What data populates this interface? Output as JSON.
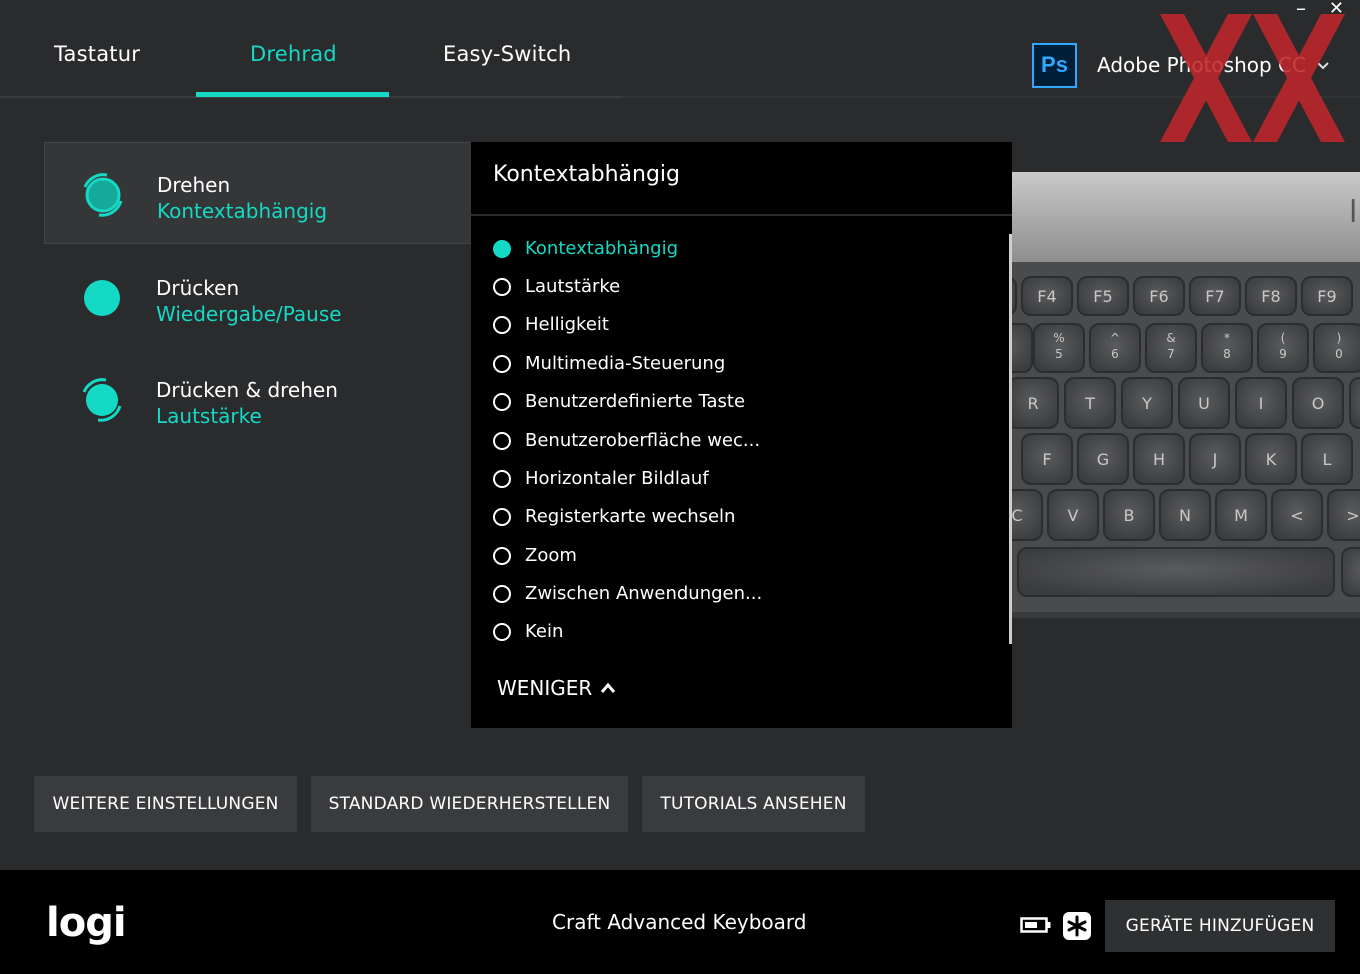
{
  "window": {
    "minimize_label": "–",
    "close_label": "✕"
  },
  "tabs": [
    {
      "label": "Tastatur",
      "active": false
    },
    {
      "label": "Drehrad",
      "active": true
    },
    {
      "label": "Easy-Switch",
      "active": false
    }
  ],
  "app_selector": {
    "icon_text": "Ps",
    "name": "Adobe Photoshop CC",
    "icon": "chevron-down-icon"
  },
  "settings": [
    {
      "title": "Drehen",
      "value": "Kontextabhängig",
      "selected": true,
      "icon": "rotate-dial-icon"
    },
    {
      "title": "Drücken",
      "value": "Wiedergabe/Pause",
      "selected": false,
      "icon": "press-dial-icon"
    },
    {
      "title": "Drücken & drehen",
      "value": "Lautstärke",
      "selected": false,
      "icon": "press-rotate-dial-icon"
    }
  ],
  "dropdown": {
    "title": "Kontextabhängig",
    "options": [
      "Kontextabhängig",
      "Lautstärke",
      "Helligkeit",
      "Multimedia-Steuerung",
      "Benutzerdefinierte Taste",
      "Benutzeroberfläche wec...",
      "Horizontaler Bildlauf",
      "Registerkarte wechseln",
      "Zoom",
      "Zwischen Anwendungen...",
      "Kein"
    ],
    "selected": "Kontextabhängig",
    "less_label": "WENIGER"
  },
  "keyboard": {
    "brand_partial": "l",
    "fn_keys": [
      "F4",
      "F5",
      "F6",
      "F7",
      "F8",
      "F9"
    ],
    "number_keys": [
      [
        "%",
        "5"
      ],
      [
        "^",
        "6"
      ],
      [
        "&",
        "7"
      ],
      [
        "*",
        "8"
      ],
      [
        "(",
        "9"
      ],
      [
        ")",
        "0"
      ]
    ],
    "row_q": [
      "R",
      "T",
      "Y",
      "U",
      "I",
      "O"
    ],
    "row_a": [
      "F",
      "G",
      "H",
      "J",
      "K",
      "L"
    ],
    "row_z": [
      "C",
      "V",
      "B",
      "N",
      "M",
      "<",
      ">"
    ]
  },
  "buttons": {
    "more_settings": "WEITERE EINSTELLUNGEN",
    "restore_defaults": "STANDARD WIEDERHERSTELLEN",
    "tutorials": "TUTORIALS ANSEHEN"
  },
  "footer": {
    "logo": "logi",
    "device": "Craft Advanced Keyboard",
    "add_devices": "GERÄTE HINZUFÜGEN"
  },
  "colors": {
    "accent": "#14d9c5",
    "background": "#2a2b2d",
    "panel": "#000000",
    "photoshop_blue": "#31a8ff"
  }
}
